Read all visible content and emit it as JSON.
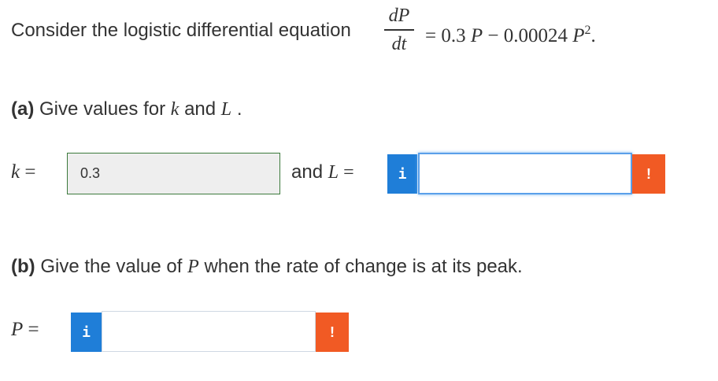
{
  "intro": {
    "text": "Consider the logistic differential equation",
    "frac_numerator": "dP",
    "frac_denominator": "dt",
    "rhs_prefix": "= 0.3 ",
    "rhs_var1": "P",
    "rhs_mid": " − 0.00024 ",
    "rhs_var2": "P",
    "rhs_exp": "2",
    "rhs_end": "."
  },
  "part_a": {
    "label": "(a)",
    "text_before_k": " Give values for ",
    "k_symbol": "k",
    "text_and": " and ",
    "l_symbol": "L",
    "text_end": " .",
    "k_label_symbol": "k",
    "k_label_eq": " =",
    "k_value": "0.3",
    "and_label": "and ",
    "l_label_symbol": "L",
    "l_label_eq": " =",
    "l_value": ""
  },
  "part_b": {
    "label": "(b)",
    "text_before_p": " Give the value of ",
    "p_symbol": "P",
    "text_after_p": " when the rate of change is at its peak.",
    "p_label_symbol": "P",
    "p_label_eq": " =",
    "p_value": ""
  },
  "buttons": {
    "info_glyph": "i",
    "warn_glyph": "!"
  },
  "colors": {
    "info_blue": "#1f7ed8",
    "warn_orange": "#f15a24",
    "correct_green_border": "#3c7a3c"
  }
}
